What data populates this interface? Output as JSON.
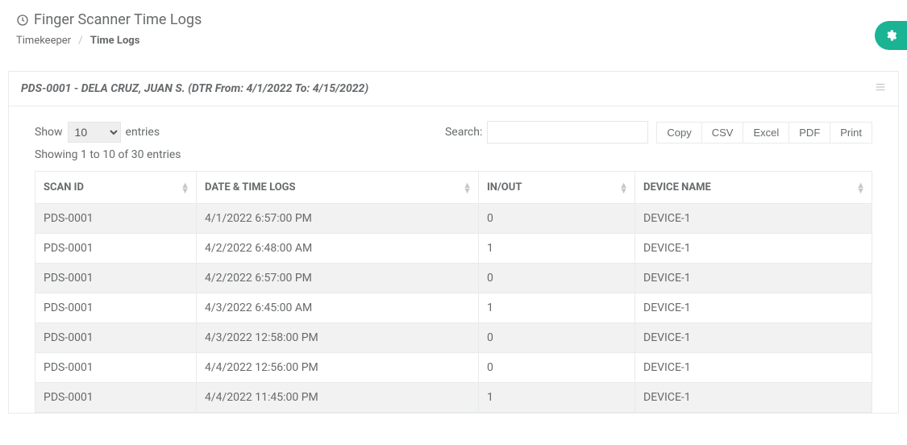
{
  "page": {
    "title": "Finger Scanner Time Logs"
  },
  "breadcrumb": {
    "parent": "Timekeeper",
    "current": "Time Logs"
  },
  "panel": {
    "title": "PDS-0001 - DELA CRUZ, JUAN S. (DTR From: 4/1/2022 To: 4/15/2022)"
  },
  "toolbar": {
    "show_label": "Show",
    "entries_label": "entries",
    "page_size": "10",
    "search_label": "Search:",
    "search_value": "",
    "search_placeholder": "",
    "buttons": {
      "copy": "Copy",
      "csv": "CSV",
      "excel": "Excel",
      "pdf": "PDF",
      "print": "Print"
    }
  },
  "info": {
    "showing": "Showing 1 to 10 of 30 entries"
  },
  "table": {
    "headers": {
      "scan_id": "SCAN ID",
      "dt_logs": "DATE & TIME LOGS",
      "in_out": "IN/OUT",
      "device": "DEVICE NAME"
    },
    "rows": [
      {
        "scan_id": "PDS-0001",
        "dt": "4/1/2022 6:57:00 PM",
        "io": "0",
        "device": "DEVICE-1"
      },
      {
        "scan_id": "PDS-0001",
        "dt": "4/2/2022 6:48:00 AM",
        "io": "1",
        "device": "DEVICE-1"
      },
      {
        "scan_id": "PDS-0001",
        "dt": "4/2/2022 6:57:00 PM",
        "io": "0",
        "device": "DEVICE-1"
      },
      {
        "scan_id": "PDS-0001",
        "dt": "4/3/2022 6:45:00 AM",
        "io": "1",
        "device": "DEVICE-1"
      },
      {
        "scan_id": "PDS-0001",
        "dt": "4/3/2022 12:58:00 PM",
        "io": "0",
        "device": "DEVICE-1"
      },
      {
        "scan_id": "PDS-0001",
        "dt": "4/4/2022 12:56:00 PM",
        "io": "0",
        "device": "DEVICE-1"
      },
      {
        "scan_id": "PDS-0001",
        "dt": "4/4/2022 11:45:00 PM",
        "io": "1",
        "device": "DEVICE-1"
      }
    ]
  },
  "col_widths": {
    "scan_id": "200px",
    "dt": "350px",
    "io": "194px",
    "device": "auto"
  }
}
